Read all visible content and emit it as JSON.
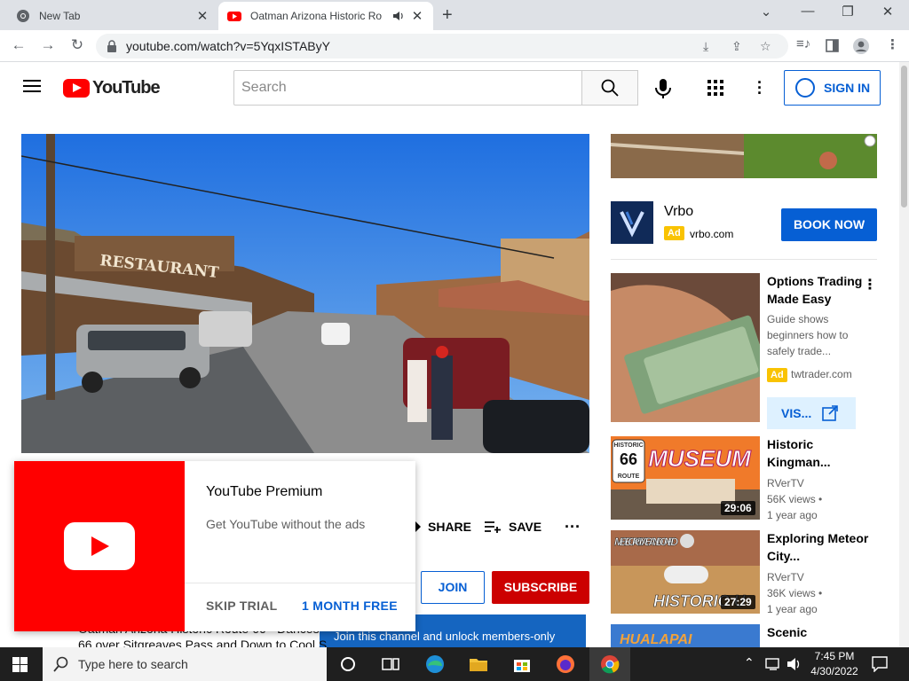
{
  "browser": {
    "tabs": [
      {
        "title": "New Tab",
        "icon": "chrome-icon"
      },
      {
        "title": "Oatman Arizona Historic Ro",
        "icon": "youtube-icon",
        "audio": "speaker-icon"
      }
    ],
    "url": "youtube.com/watch?v=5YqxISTAByY"
  },
  "youtube": {
    "logo_text": "YouTube",
    "search_placeholder": "Search",
    "sign_in": "SIGN IN"
  },
  "video": {
    "restaurant_sign": "RESTAURANT",
    "share_label": "SHARE",
    "save_label": "SAVE",
    "join_label": "JOIN",
    "subscribe_label": "SUBSCRIBE",
    "members_text": "Join this channel and unlock members-only",
    "description_line1": "Oatman Arizona Historic Route 66 - Dances",
    "description_line2": "66 over Sitgreaves Pass and Down to Cool S"
  },
  "premium_popup": {
    "title": "YouTube Premium",
    "subtitle": "Get YouTube without the ads",
    "skip_label": "SKIP TRIAL",
    "month_label": "1 MONTH FREE"
  },
  "sidebar": {
    "vrbo": {
      "name": "Vrbo",
      "ad_badge": "Ad",
      "url": "vrbo.com",
      "button": "BOOK NOW"
    },
    "options_ad": {
      "title": "Options Trading Made Easy",
      "desc": "Guide shows beginners how to safely trade...",
      "ad_badge": "Ad",
      "url": "twtrader.com",
      "visit": "VIS..."
    },
    "videos": [
      {
        "title": "Historic Kingman...",
        "channel": "RVerTV",
        "views": "56K views •",
        "age": "1 year ago",
        "duration": "29:06",
        "thumb_text": "MUSEUM",
        "badge_text1": "HISTORIC",
        "badge_text2": "66",
        "badge_text3": "ROUTE"
      },
      {
        "title": "Exploring Meteor City...",
        "channel": "RVerTV",
        "views": "36K views •",
        "age": "1 year ago",
        "duration": "27:29",
        "thumb_text": "METEOR CITY ABANDONED",
        "thumb_text2": "HISTORIC U"
      },
      {
        "title": "Scenic",
        "thumb_text": "HUALAPAI"
      }
    ]
  },
  "taskbar": {
    "search_text": "Type here to search",
    "time": "7:45 PM",
    "date": "4/30/2022"
  },
  "colors": {
    "youtube_red": "#ff0000",
    "link_blue": "#065fd4",
    "subscribe_red": "#cc0000",
    "ad_yellow": "#f9c302"
  }
}
